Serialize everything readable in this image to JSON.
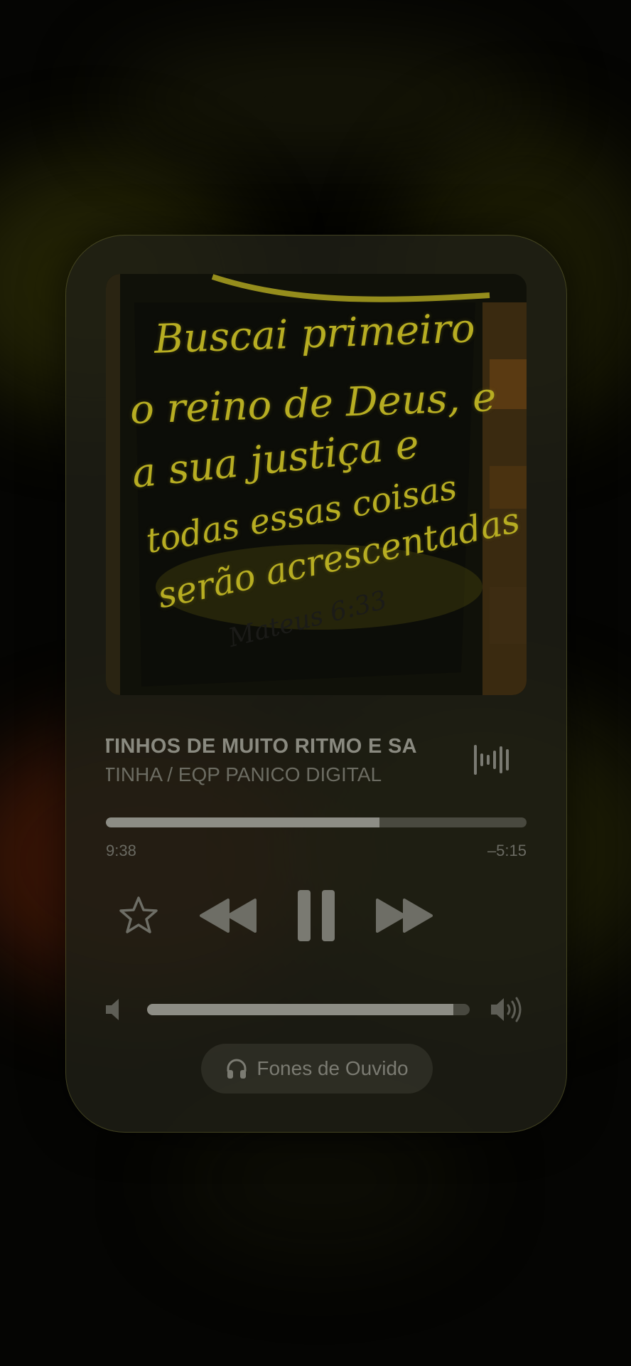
{
  "now_playing": {
    "artwork": {
      "lines": [
        "Buscai primeiro",
        "o reino de Deus, e",
        "a sua justiça e",
        "todas essas coisas",
        "serão acrescentadas",
        "Mateus 6:33"
      ]
    },
    "track_title": "TINHOS DE MUITO RITMO E SA",
    "track_artist": "TINHA / EQP PANICO DIGITAL",
    "progress": {
      "elapsed": "9:38",
      "remaining": "–5:15",
      "fraction": 0.65
    },
    "volume": {
      "fraction": 0.95
    },
    "output_route": {
      "label": "Fones de Ouvido",
      "icon": "headphones-icon"
    },
    "colors": {
      "accent_text": "#8a8a80",
      "artwork_text": "#b7ad22",
      "card_background": "#20201a"
    }
  }
}
